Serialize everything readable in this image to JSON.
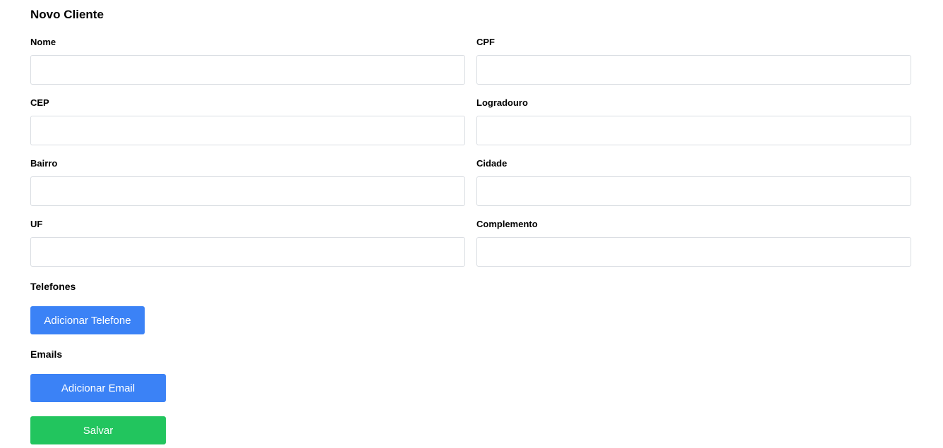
{
  "form": {
    "title": "Novo Cliente",
    "fields": {
      "nome": {
        "label": "Nome",
        "value": "",
        "placeholder": ""
      },
      "cpf": {
        "label": "CPF",
        "value": "",
        "placeholder": ""
      },
      "cep": {
        "label": "CEP",
        "value": "",
        "placeholder": ""
      },
      "logradouro": {
        "label": "Logradouro",
        "value": "",
        "placeholder": ""
      },
      "bairro": {
        "label": "Bairro",
        "value": "",
        "placeholder": ""
      },
      "cidade": {
        "label": "Cidade",
        "value": "",
        "placeholder": ""
      },
      "uf": {
        "label": "UF",
        "value": "",
        "placeholder": ""
      },
      "complemento": {
        "label": "Complemento",
        "value": "",
        "placeholder": ""
      }
    },
    "telefones": {
      "title": "Telefones",
      "add_label": "Adicionar Telefone"
    },
    "emails": {
      "title": "Emails",
      "add_label": "Adicionar Email"
    },
    "save_label": "Salvar"
  },
  "colors": {
    "primary": "#3b82f6",
    "success": "#22c55e",
    "input_border": "#d9dde2"
  }
}
